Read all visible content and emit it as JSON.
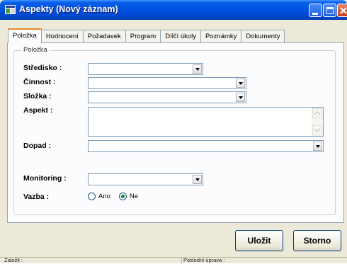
{
  "window": {
    "title": "Aspekty (Nový záznam)"
  },
  "tabs": [
    {
      "label": "Položka",
      "active": true
    },
    {
      "label": "Hodnocení",
      "active": false
    },
    {
      "label": "Požadavek",
      "active": false
    },
    {
      "label": "Program",
      "active": false
    },
    {
      "label": "Dílčí úkoly",
      "active": false
    },
    {
      "label": "Poznámky",
      "active": false
    },
    {
      "label": "Dokumenty",
      "active": false
    }
  ],
  "group": {
    "legend": "Položka"
  },
  "fields": {
    "stredisko": {
      "label": "Středisko :",
      "value": ""
    },
    "cinnost": {
      "label": "Činnost :",
      "value": ""
    },
    "slozka": {
      "label": "Složka :",
      "value": ""
    },
    "aspekt": {
      "label": "Aspekt :",
      "value": ""
    },
    "dopad": {
      "label": "Dopad :",
      "value": ""
    },
    "monitoring": {
      "label": "Monitoring :",
      "value": ""
    },
    "vazba": {
      "label": "Vazba :",
      "options": [
        {
          "label": "Ano",
          "checked": false
        },
        {
          "label": "Ne",
          "checked": true
        }
      ]
    }
  },
  "buttons": {
    "save": "Uložit",
    "cancel": "Storno"
  },
  "statusbar": {
    "created": "Založil :",
    "modified": "Poslední úprava :"
  },
  "colors": {
    "titlebar": "#0054e3",
    "active_tab_accent": "#e68b2c",
    "window_bg": "#ece9d8"
  }
}
